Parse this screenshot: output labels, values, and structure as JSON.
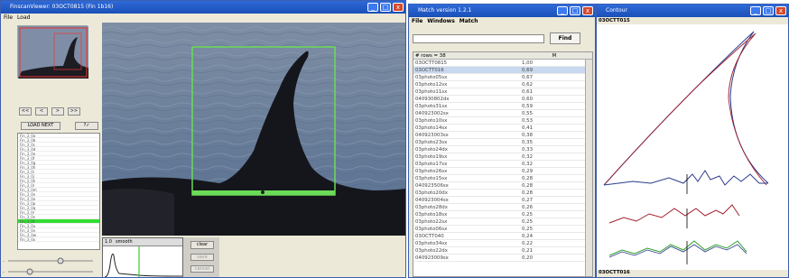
{
  "viewer": {
    "title": "FinscanViewer: 03OCT0815 (Fin 1b16)",
    "menu": [
      "File",
      "Load"
    ],
    "load_button": "LOAD NEXT",
    "small_list": [
      "Fin_3_0a",
      "Fin_3_0b",
      "Fin_3_0c",
      "Fin_3_0d",
      "Fin_3_0e",
      "Fin_3_0f",
      "Fin_3_0g",
      "Fin_3_0h",
      "Fin_3_0i",
      "Fin_3_0j",
      "Fin_3_0k",
      "Fin_3_0l",
      "Fin_3_0m",
      "Fin_3_0n",
      "Fin_3_0o",
      "Fin_3_0p",
      "Fin_3_0q",
      "Fin_3_0r",
      "Fin_3_0s",
      "Fin_3_0t",
      "Fin_3_0u",
      "Fin_3_0v",
      "Fin_3_0w",
      "Fin_3_0x"
    ],
    "selected_index": 19,
    "bottom_buttons": [
      "clear",
      "save",
      "cancel"
    ],
    "graph_toolbar": [
      "1.0",
      "smooth"
    ]
  },
  "match": {
    "title": "Match version 1.2.1",
    "menu": [
      "File",
      "Windows",
      "Match"
    ],
    "find_label": "Find",
    "search_value": "",
    "rows_label": "# rows = 38",
    "col_header": "M",
    "rows": [
      [
        "03OCTT0815",
        "1,00"
      ],
      [
        "03OCTT016",
        "0,69"
      ],
      [
        "03photo05sx",
        "0,67"
      ],
      [
        "03photo12sx",
        "0,62"
      ],
      [
        "03photo11sx",
        "0,61"
      ],
      [
        "040930802dx",
        "0,60"
      ],
      [
        "03photo31sx",
        "0,59"
      ],
      [
        "040923002sx",
        "0,55"
      ],
      [
        "03photo10sx",
        "0,53"
      ],
      [
        "03photo14sx",
        "0,41"
      ],
      [
        "040923003sx",
        "0,38"
      ],
      [
        "03photo23sx",
        "0,35"
      ],
      [
        "03photo24dx",
        "0,33"
      ],
      [
        "03photo19sx",
        "0,32"
      ],
      [
        "03photo17sx",
        "0,32"
      ],
      [
        "03photo26sx",
        "0,29"
      ],
      [
        "03photo15sx",
        "0,28"
      ],
      [
        "040923506sx",
        "0,28"
      ],
      [
        "03photo20dx",
        "0,28"
      ],
      [
        "040923004sx",
        "0,27"
      ],
      [
        "03photo28dx",
        "0,26"
      ],
      [
        "03photo18sx",
        "0,25"
      ],
      [
        "03photo22sx",
        "0,25"
      ],
      [
        "03photo06sx",
        "0,25"
      ],
      [
        "03OCTT040",
        "0,24"
      ],
      [
        "03photo34sx",
        "0,22"
      ],
      [
        "03photo22dx",
        "0,21"
      ],
      [
        "040923009sx",
        "0,20"
      ]
    ],
    "selected_index": 1
  },
  "contour": {
    "title": "Contour",
    "top_label": "03OCTT015",
    "bottom_label": "03OCTT016"
  },
  "colors": {
    "title_bar": "#1f5ac8",
    "selection_green": "#33dd33",
    "box_green": "#66dd55",
    "contour_blue": "#2c3a8a",
    "contour_red": "#a02030",
    "contour_green": "#30a030"
  }
}
